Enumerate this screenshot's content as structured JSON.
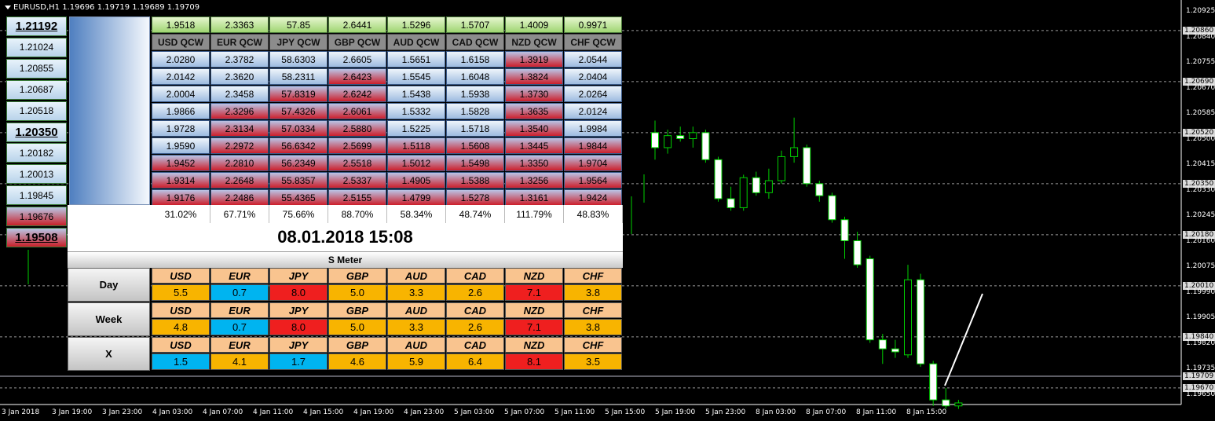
{
  "window": {
    "title": "EURUSD,H1  1.19696 1.19719 1.19689 1.19709"
  },
  "price_axis": [
    "1.20925",
    "1.20860",
    "1.20840",
    "1.20755",
    "1.20690",
    "1.20670",
    "1.20585",
    "1.20520",
    "1.20500",
    "1.20415",
    "1.20350",
    "1.20330",
    "1.20245",
    "1.20180",
    "1.20160",
    "1.20075",
    "1.20010",
    "1.19990",
    "1.19905",
    "1.19840",
    "1.19820",
    "1.19735",
    "1.19709",
    "1.19670",
    "1.19650"
  ],
  "time_axis": [
    "3 Jan 2018",
    "3 Jan 19:00",
    "3 Jan 23:00",
    "4 Jan 03:00",
    "4 Jan 07:00",
    "4 Jan 11:00",
    "4 Jan 15:00",
    "4 Jan 19:00",
    "4 Jan 23:00",
    "5 Jan 03:00",
    "5 Jan 07:00",
    "5 Jan 11:00",
    "5 Jan 15:00",
    "5 Jan 19:00",
    "5 Jan 23:00",
    "8 Jan 03:00",
    "8 Jan 07:00",
    "8 Jan 11:00",
    "8 Jan 15:00"
  ],
  "ladder": [
    {
      "v": "1.21192",
      "style": "big"
    },
    {
      "v": "1.21024",
      "style": ""
    },
    {
      "v": "1.20855",
      "style": ""
    },
    {
      "v": "1.20687",
      "style": ""
    },
    {
      "v": "1.20518",
      "style": ""
    },
    {
      "v": "1.20350",
      "style": "big"
    },
    {
      "v": "1.20182",
      "style": ""
    },
    {
      "v": "1.20013",
      "style": ""
    },
    {
      "v": "1.19845",
      "style": ""
    },
    {
      "v": "1.19676",
      "style": "red"
    },
    {
      "v": "1.19508",
      "style": "big red"
    }
  ],
  "qcw": {
    "top": [
      "1.9518",
      "2.3363",
      "57.85",
      "2.6441",
      "1.5296",
      "1.5707",
      "1.4009",
      "0.9971"
    ],
    "headers": [
      "USD  QCW",
      "EUR QCW",
      "JPY QCW",
      "GBP QCW",
      "AUD QCW",
      "CAD QCW",
      "NZD QCW",
      "CHF QCW"
    ],
    "rows": [
      [
        "2.0280",
        "2.3782",
        "58.6303",
        "2.6605",
        "1.5651",
        "1.6158",
        "1.3919",
        "2.0544"
      ],
      [
        "2.0142",
        "2.3620",
        "58.2311",
        "2.6423",
        "1.5545",
        "1.6048",
        "1.3824",
        "2.0404"
      ],
      [
        "2.0004",
        "2.3458",
        "57.8319",
        "2.6242",
        "1.5438",
        "1.5938",
        "1.3730",
        "2.0264"
      ],
      [
        "1.9866",
        "2.3296",
        "57.4326",
        "2.6061",
        "1.5332",
        "1.5828",
        "1.3635",
        "2.0124"
      ],
      [
        "1.9728",
        "2.3134",
        "57.0334",
        "2.5880",
        "1.5225",
        "1.5718",
        "1.3540",
        "1.9984"
      ],
      [
        "1.9590",
        "2.2972",
        "56.6342",
        "2.5699",
        "1.5118",
        "1.5608",
        "1.3445",
        "1.9844"
      ],
      [
        "1.9452",
        "2.2810",
        "56.2349",
        "2.5518",
        "1.5012",
        "1.5498",
        "1.3350",
        "1.9704"
      ],
      [
        "1.9314",
        "2.2648",
        "55.8357",
        "2.5337",
        "1.4905",
        "1.5388",
        "1.3256",
        "1.9564"
      ],
      [
        "1.9176",
        "2.2486",
        "55.4365",
        "2.5155",
        "1.4799",
        "1.5278",
        "1.3161",
        "1.9424"
      ]
    ],
    "red_from": [
      6,
      3,
      2,
      1,
      5,
      5,
      0,
      5
    ],
    "percent": [
      "31.02%",
      "67.71%",
      "75.66%",
      "88.70%",
      "58.34%",
      "48.74%",
      "111.79%",
      "48.83%"
    ]
  },
  "datetime": "08.01.2018 15:08",
  "smeter_title": "S Meter",
  "smeter": [
    {
      "label": "Day",
      "currencies": [
        "USD",
        "EUR",
        "JPY",
        "GBP",
        "AUD",
        "CAD",
        "NZD",
        "CHF"
      ],
      "values": [
        "5.5",
        "0.7",
        "8.0",
        "5.0",
        "3.3",
        "2.6",
        "7.1",
        "3.8"
      ],
      "colors": [
        "orange",
        "cyan",
        "red",
        "orange",
        "orange",
        "orange",
        "red",
        "orange"
      ]
    },
    {
      "label": "Week",
      "currencies": [
        "USD",
        "EUR",
        "JPY",
        "GBP",
        "AUD",
        "CAD",
        "NZD",
        "CHF"
      ],
      "values": [
        "4.8",
        "0.7",
        "8.0",
        "5.0",
        "3.3",
        "2.6",
        "7.1",
        "3.8"
      ],
      "colors": [
        "orange",
        "cyan",
        "red",
        "orange",
        "orange",
        "orange",
        "red",
        "orange"
      ]
    },
    {
      "label": "X",
      "currencies": [
        "USD",
        "EUR",
        "JPY",
        "GBP",
        "AUD",
        "CAD",
        "NZD",
        "CHF"
      ],
      "values": [
        "1.5",
        "4.1",
        "1.7",
        "4.6",
        "5.9",
        "6.4",
        "8.1",
        "3.5"
      ],
      "colors": [
        "cyan",
        "orange",
        "cyan",
        "orange",
        "orange",
        "orange",
        "red",
        "orange"
      ]
    }
  ],
  "candles": [
    {
      "o": 1.2052,
      "c": 1.2047,
      "h": 1.2056,
      "l": 1.2043
    },
    {
      "o": 1.2047,
      "c": 1.2051,
      "h": 1.2053,
      "l": 1.2045
    },
    {
      "o": 1.2051,
      "c": 1.205,
      "h": 1.2054,
      "l": 1.2049
    },
    {
      "o": 1.205,
      "c": 1.2052,
      "h": 1.2054,
      "l": 1.2047
    },
    {
      "o": 1.2052,
      "c": 1.2043,
      "h": 1.2053,
      "l": 1.2042
    },
    {
      "o": 1.2043,
      "c": 1.203,
      "h": 1.2044,
      "l": 1.2029
    },
    {
      "o": 1.203,
      "c": 1.2027,
      "h": 1.2034,
      "l": 1.2026
    },
    {
      "o": 1.2027,
      "c": 1.2037,
      "h": 1.2038,
      "l": 1.2026
    },
    {
      "o": 1.2037,
      "c": 1.2032,
      "h": 1.2039,
      "l": 1.2031
    },
    {
      "o": 1.2032,
      "c": 1.2036,
      "h": 1.204,
      "l": 1.203
    },
    {
      "o": 1.2036,
      "c": 1.2044,
      "h": 1.2046,
      "l": 1.2035
    },
    {
      "o": 1.2044,
      "c": 1.2047,
      "h": 1.2057,
      "l": 1.2042
    },
    {
      "o": 1.2047,
      "c": 1.2035,
      "h": 1.2048,
      "l": 1.2034
    },
    {
      "o": 1.2035,
      "c": 1.2031,
      "h": 1.2036,
      "l": 1.2029
    },
    {
      "o": 1.2031,
      "c": 1.2023,
      "h": 1.2032,
      "l": 1.2022
    },
    {
      "o": 1.2023,
      "c": 1.2016,
      "h": 1.2024,
      "l": 1.201
    },
    {
      "o": 1.2016,
      "c": 1.2008,
      "h": 1.2019,
      "l": 1.2007
    },
    {
      "o": 1.201,
      "c": 1.1983,
      "h": 1.2011,
      "l": 1.1982
    },
    {
      "o": 1.1983,
      "c": 1.198,
      "h": 1.1985,
      "l": 1.1975
    },
    {
      "o": 1.198,
      "c": 1.1979,
      "h": 1.1983,
      "l": 1.1977
    },
    {
      "o": 1.1978,
      "c": 1.2003,
      "h": 1.2008,
      "l": 1.1977
    },
    {
      "o": 1.2003,
      "c": 1.1975,
      "h": 1.2005,
      "l": 1.1974
    },
    {
      "o": 1.1975,
      "c": 1.1963,
      "h": 1.1976,
      "l": 1.1961
    },
    {
      "o": 1.1963,
      "c": 1.1961,
      "h": 1.1967,
      "l": 1.196
    },
    {
      "o": 1.1961,
      "c": 1.1962,
      "h": 1.1963,
      "l": 1.196
    }
  ]
}
